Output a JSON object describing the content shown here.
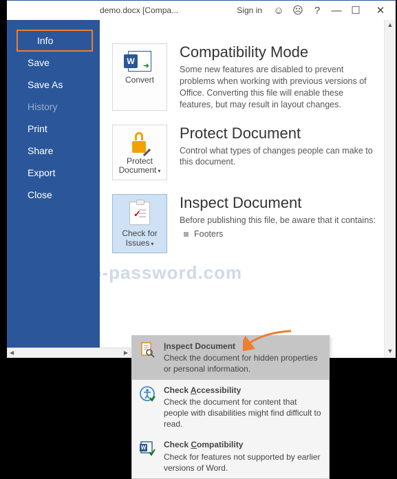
{
  "titlebar": {
    "title": "demo.docx [Compa...",
    "signin": "Sign in",
    "help": "?",
    "min": "—",
    "max": "☐",
    "close": "✕"
  },
  "sidebar": {
    "items": [
      {
        "label": "Info",
        "selected": true
      },
      {
        "label": "Save"
      },
      {
        "label": "Save As"
      },
      {
        "label": "History",
        "dim": true
      },
      {
        "label": "Print"
      },
      {
        "label": "Share"
      },
      {
        "label": "Export"
      },
      {
        "label": "Close"
      }
    ]
  },
  "sections": {
    "compat": {
      "btn": "Convert",
      "h": "Compatibility Mode",
      "desc": "Some new features are disabled to prevent problems when working with previous versions of Office. Converting this file will enable these features, but may result in layout changes."
    },
    "protect": {
      "btn": "Protect Document",
      "h": "Protect Document",
      "desc": "Control what types of changes people can make to this document."
    },
    "inspect": {
      "btn": "Check for Issues",
      "h": "Inspect Document",
      "desc": "Before publishing this file, be aware that it contains:",
      "bullets": [
        "Footers"
      ]
    }
  },
  "menu": {
    "items": [
      {
        "t1": "Inspect Document",
        "u": "I",
        "rest": "nspect Document",
        "d": "Check the document for hidden properties or personal information."
      },
      {
        "t1": "Check Accessibility",
        "u": "A",
        "rest": "ccessibility",
        "pre": "Check ",
        "d": "Check the document for content that people with disabilities might find difficult to read."
      },
      {
        "t1": "Check Compatibility",
        "u": "C",
        "rest": "ompatibility",
        "pre": "Check ",
        "d": "Check for features not supported by earlier versions of Word."
      }
    ]
  },
  "watermark": "top-password.com"
}
